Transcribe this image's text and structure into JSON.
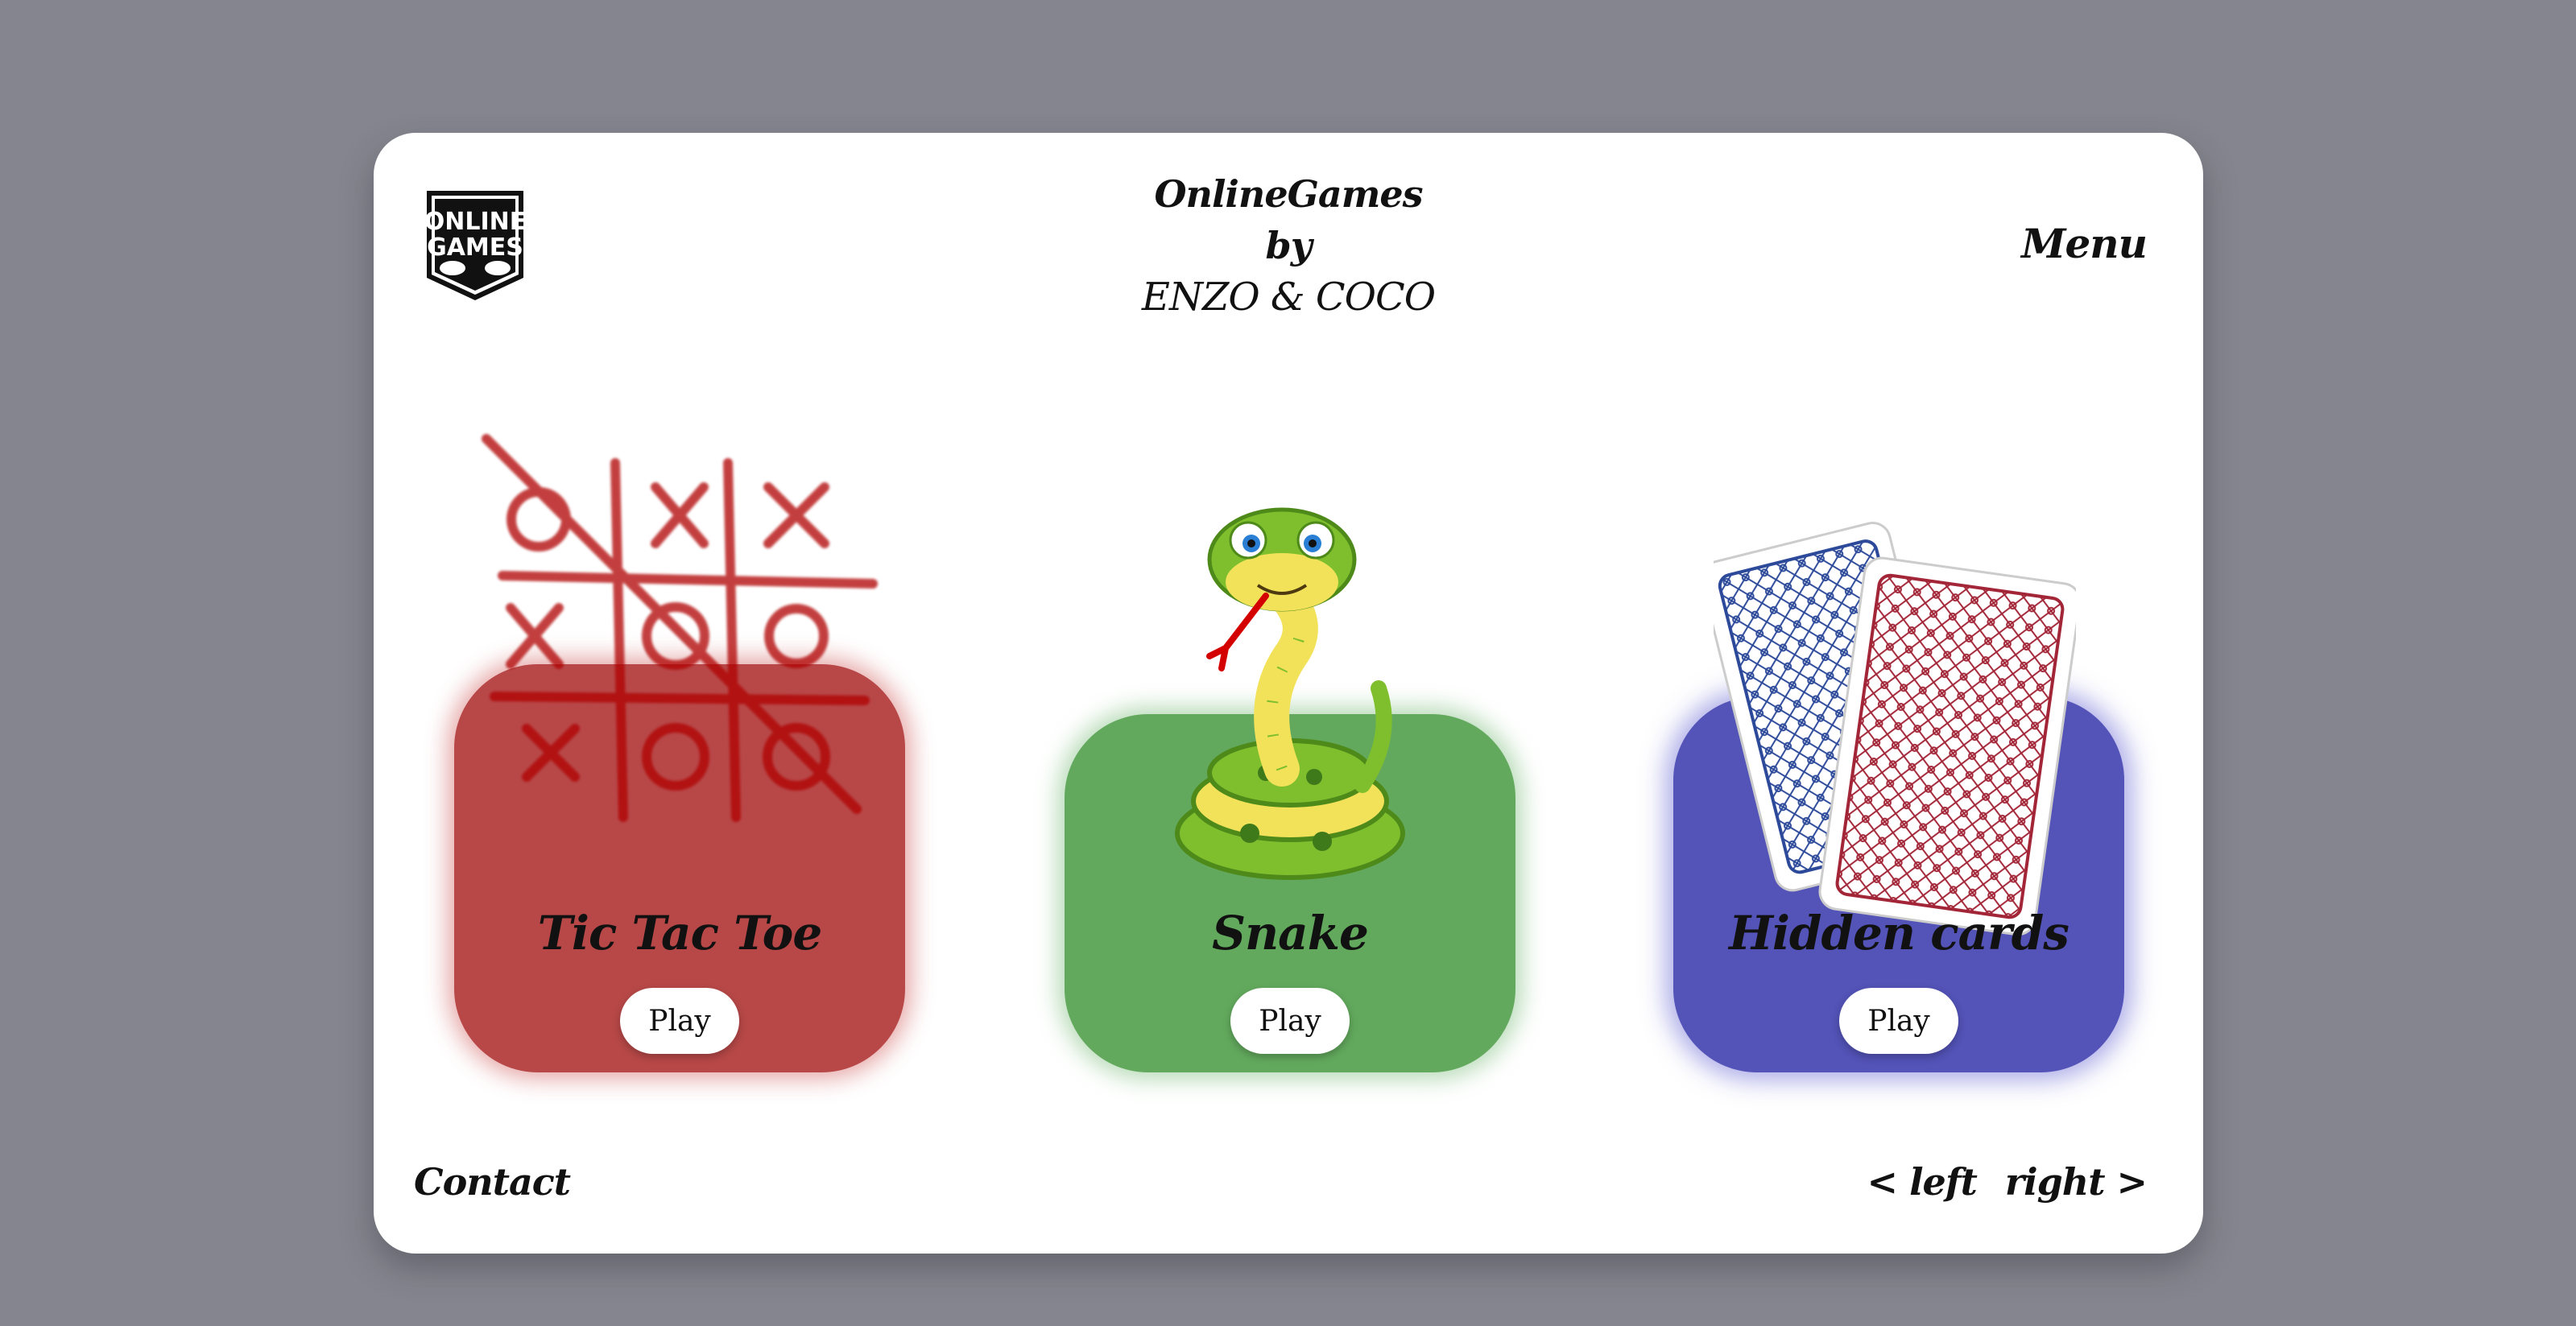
{
  "header": {
    "title_line1": "OnlineGames",
    "title_line2": "by",
    "title_line3": "ENZO & COCO",
    "menu_label": "Menu",
    "logo_text_top": "ONLINE",
    "logo_text_bottom": "GAMES"
  },
  "games": [
    {
      "name": "Tic Tac Toe",
      "play_label": "Play",
      "color": "#b84848",
      "icon": "tic-tac-toe-board"
    },
    {
      "name": "Snake",
      "play_label": "Play",
      "color": "#62a95d",
      "icon": "cartoon-snake"
    },
    {
      "name": "Hidden cards",
      "play_label": "Play",
      "color": "#5353b8",
      "icon": "playing-cards"
    }
  ],
  "footer": {
    "contact_label": "Contact",
    "left_label": "< left",
    "right_label": "right >"
  },
  "colors": {
    "background": "#85858f",
    "panel": "#ffffff"
  }
}
